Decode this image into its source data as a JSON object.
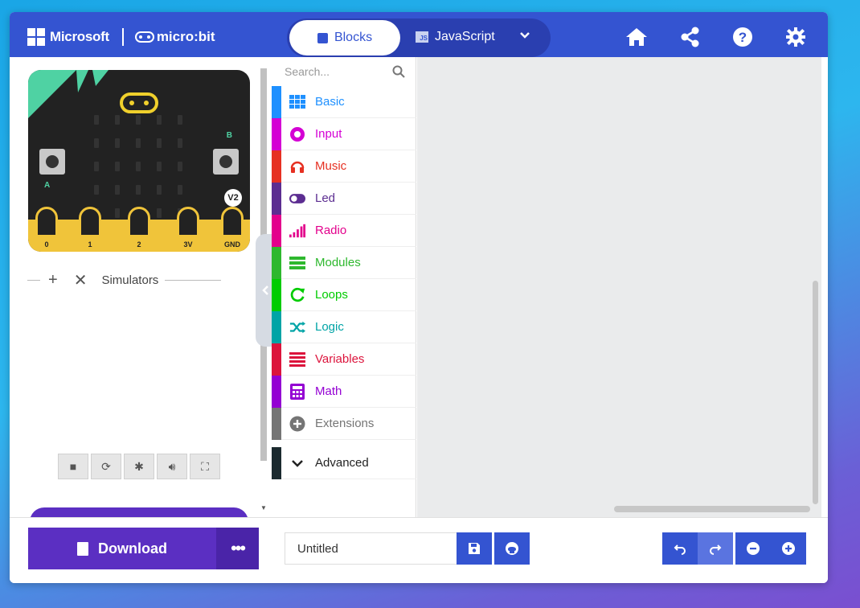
{
  "header": {
    "brand_ms": "Microsoft",
    "brand_mb": "micro:bit",
    "tabs": [
      {
        "label": "Blocks",
        "active": true
      },
      {
        "label": "JavaScript",
        "active": false
      }
    ],
    "icons": [
      "home-icon",
      "share-icon",
      "help-icon",
      "settings-icon"
    ]
  },
  "simulator": {
    "pins": [
      "0",
      "1",
      "2",
      "3V",
      "GND"
    ],
    "version": "V2",
    "button_a": "A",
    "button_b": "B",
    "toolbar_label": "Simulators",
    "controls": [
      "stop-icon",
      "restart-icon",
      "debug-icon",
      "mute-icon",
      "fullscreen-icon"
    ]
  },
  "toolbox": {
    "search_placeholder": "Search...",
    "categories": [
      {
        "label": "Basic",
        "color": "#1e90ff",
        "icon": "grid-icon"
      },
      {
        "label": "Input",
        "color": "#d400d4",
        "icon": "target-icon"
      },
      {
        "label": "Music",
        "color": "#e63022",
        "icon": "headphones-icon"
      },
      {
        "label": "Led",
        "color": "#5c2d91",
        "icon": "toggle-icon"
      },
      {
        "label": "Radio",
        "color": "#e3008c",
        "icon": "signal-icon"
      },
      {
        "label": "Modules",
        "color": "#2eb82e",
        "icon": "list-icon"
      },
      {
        "label": "Loops",
        "color": "#00cc00",
        "icon": "refresh-icon"
      },
      {
        "label": "Logic",
        "color": "#00a4a6",
        "icon": "shuffle-icon"
      },
      {
        "label": "Variables",
        "color": "#dc143c",
        "icon": "lines-icon"
      },
      {
        "label": "Math",
        "color": "#9400d3",
        "icon": "calculator-icon"
      },
      {
        "label": "Extensions",
        "color": "#757575",
        "icon": "plus-circle-icon"
      }
    ],
    "advanced": {
      "label": "Advanced",
      "color": "#1b2a2f"
    }
  },
  "footer": {
    "download_label": "Download",
    "more_label": "•••",
    "project_name": "Untitled"
  }
}
